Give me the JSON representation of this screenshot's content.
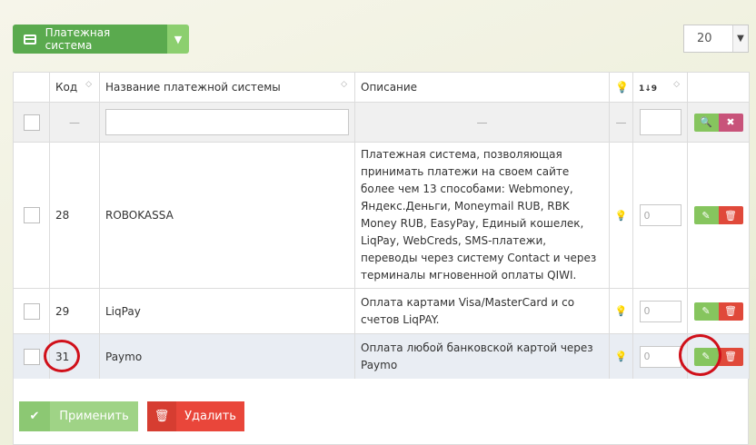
{
  "toolbar": {
    "add_label": "Платежная система",
    "per_page": "20"
  },
  "table": {
    "headers": {
      "code": "Код",
      "name": "Название платежной системы",
      "description": "Описание",
      "sort_icon": "1↓9"
    },
    "filter": {
      "dash": "—"
    },
    "rows": [
      {
        "code": "28",
        "name": "ROBOKASSA",
        "description": "Платежная система, позволяющая принимать платежи на своем сайте более чем 13 способами: Webmoney, Яндекс.Деньги, Moneymail RUB, RBK Money RUB, EasyPay, Единый кошелек, LiqPay, WebCreds, SMS-платежи, переводы через систему Contact и через терминалы мгновенной оплаты QIWI.",
        "order": "0"
      },
      {
        "code": "29",
        "name": "LiqPay",
        "description": "Оплата картами Visa/MasterCard и со счетов LiqPAY.",
        "order": "0"
      },
      {
        "code": "31",
        "name": "Paymo",
        "description": "Оплата любой банковской картой через Paymo",
        "order": "0"
      }
    ]
  },
  "actions": {
    "apply_label": "Применить",
    "delete_label": "Удалить"
  },
  "colors": {
    "green": "#5aaa4e",
    "red": "#e0493a",
    "highlight_ring": "#d0101a"
  }
}
